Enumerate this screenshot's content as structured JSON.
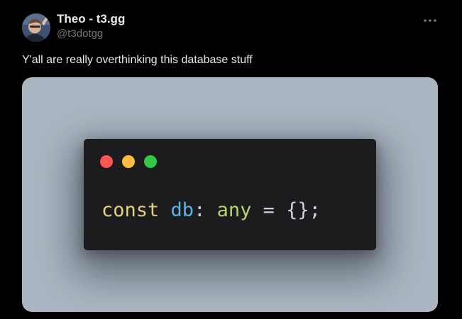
{
  "author": {
    "display_name": "Theo - t3.gg",
    "handle": "@t3dotgg"
  },
  "header": {
    "more_icon": "more-horizontal-icon"
  },
  "tweet": {
    "text": "Y'all are really overthinking this database stuff"
  },
  "media": {
    "card_color": "#abb6c2",
    "window_color": "#1c1c1e",
    "traffic_lights": [
      "#fc5753",
      "#fdbc40",
      "#33c748"
    ],
    "code": {
      "keyword": "const",
      "identifier": "db",
      "colon": ":",
      "type": "any",
      "operator": "=",
      "value": "{};"
    }
  }
}
